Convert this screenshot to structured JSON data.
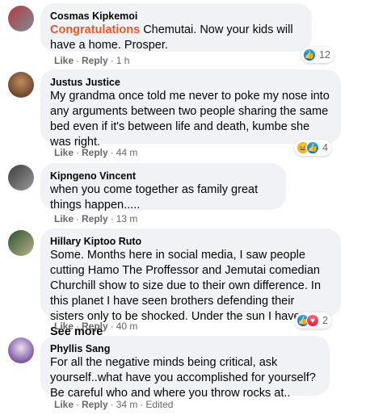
{
  "comments": [
    {
      "author": "Cosmas Kipkemoi",
      "highlight": "Congratulations",
      "text": " Chemutai. Now your kids will have a home. Prosper.",
      "like": "Like",
      "reply": "Reply",
      "time": "1 h",
      "reaction_count": "12",
      "reaction_icons": [
        "like-icon"
      ],
      "avatar_colors": [
        "#a33",
        "#7b8c99"
      ]
    },
    {
      "author": "Justus Justice",
      "text": "My grandma once told me never to poke my nose into any arguments between two people sharing the same bed even if it's between life and death, kumbe she was right.",
      "like": "Like",
      "reply": "Reply",
      "time": "44 m",
      "reaction_count": "4",
      "reaction_icons": [
        "haha-icon",
        "like-icon"
      ],
      "avatar_colors": [
        "#6b4a2e",
        "#c48a5a"
      ]
    },
    {
      "author": "Kipngeno Vincent",
      "text": "when you come together as family great things happen.....",
      "like": "Like",
      "reply": "Reply",
      "time": "13 m",
      "avatar_colors": [
        "#3d3d3d",
        "#8b8b8b"
      ]
    },
    {
      "author": "Hillary Kiptoo Ruto",
      "text": "Some. Months here in social media, I saw people cutting Hamo The Proffessor and Jemutai comedian Churchill show to size due to their own difference. In this planet I have seen brothers defending their sisters only to be shocked. Under the sun I have ...",
      "see_more": "See more",
      "like": "Like",
      "reply": "Reply",
      "time": "40 m",
      "reaction_count": "2",
      "reaction_icons": [
        "like-icon",
        "love-icon"
      ],
      "avatar_colors": [
        "#2f4f2f",
        "#9aa07a"
      ]
    },
    {
      "author": "Phyllis Sang",
      "text": "For all the negative minds being critical, ask yourself..what have you accomplished for yourself?Be careful who and where you throw rocks at..",
      "like": "Like",
      "reply": "Reply",
      "time": "34 m",
      "edited": "Edited",
      "avatar_colors": [
        "#7a4fa0",
        "#e9dff2"
      ]
    }
  ]
}
